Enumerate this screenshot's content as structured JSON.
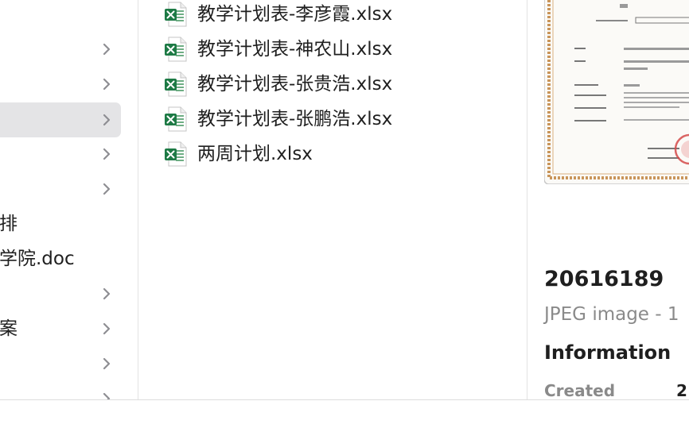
{
  "colors": {
    "selection": "#e4e4e6",
    "chevron": "#8e8e93",
    "excel_green": "#1d7a45",
    "secondary_text": "#8a8a8a",
    "certificate_border": "#c9955a"
  },
  "left_column": {
    "rows": [
      {
        "label": "",
        "has_chevron": true,
        "selected": false
      },
      {
        "label": "",
        "has_chevron": true,
        "selected": false
      },
      {
        "label": "",
        "has_chevron": true,
        "selected": true
      },
      {
        "label": "",
        "has_chevron": true,
        "selected": false
      },
      {
        "label": "",
        "has_chevron": true,
        "selected": false
      },
      {
        "label": "排",
        "has_chevron": false,
        "selected": false
      },
      {
        "label": "学院.doc",
        "has_chevron": false,
        "selected": false
      },
      {
        "label": "",
        "has_chevron": true,
        "selected": false
      },
      {
        "label": "案",
        "has_chevron": true,
        "selected": false
      },
      {
        "label": "",
        "has_chevron": true,
        "selected": false
      },
      {
        "label": "",
        "has_chevron": true,
        "selected": false
      }
    ]
  },
  "middle_column": {
    "files": [
      {
        "name": "教学计划表-李彦霞.xlsx",
        "icon": "excel-file-icon"
      },
      {
        "name": "教学计划表-神农山.xlsx",
        "icon": "excel-file-icon"
      },
      {
        "name": "教学计划表-张贵浩.xlsx",
        "icon": "excel-file-icon"
      },
      {
        "name": "教学计划表-张鹏浩.xlsx",
        "icon": "excel-file-icon"
      },
      {
        "name": "两周计划.xlsx",
        "icon": "excel-file-icon"
      }
    ]
  },
  "preview": {
    "thumbnail_icon": "certificate-image-thumbnail",
    "title": "20616189",
    "kind": "JPEG image - 1",
    "info_heading": "Information",
    "created_label": "Created",
    "created_value": "2"
  }
}
